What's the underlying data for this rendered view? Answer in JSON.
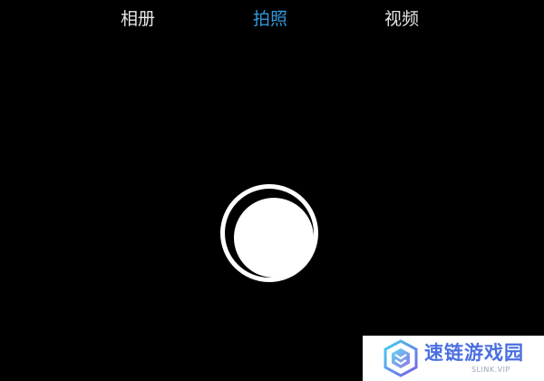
{
  "mode_tabs": [
    {
      "label": "相册",
      "active": false
    },
    {
      "label": "拍照",
      "active": true
    },
    {
      "label": "视频",
      "active": false
    }
  ],
  "colors": {
    "background": "#000000",
    "tab_text": "#e6e6e6",
    "tab_active": "#2f98d8",
    "shutter": "#ffffff",
    "watermark_text": "#4a6fe0"
  },
  "shutter": {
    "icon": "shutter-button"
  },
  "watermark": {
    "title": "速链游戏园",
    "subtitle": "SLINK.VIP"
  }
}
